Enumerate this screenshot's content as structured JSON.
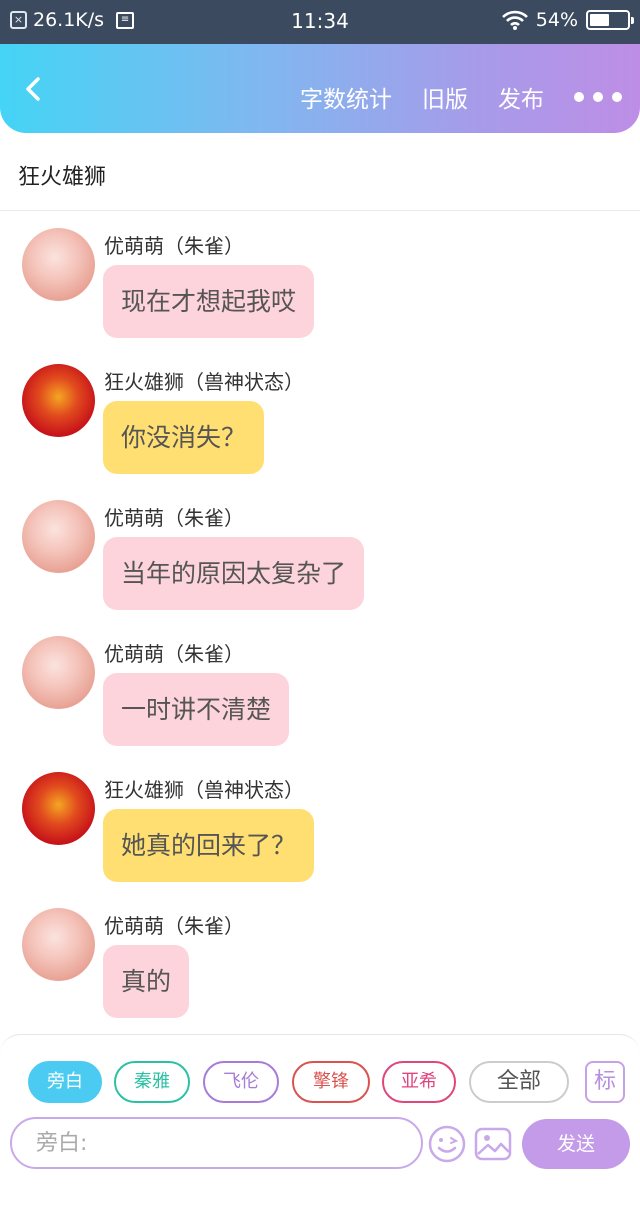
{
  "status_bar": {
    "net_speed": "26.1K/s",
    "time": "11:34",
    "battery_percent": "54%",
    "battery_level": 0.54,
    "left_icons": [
      "close-box-icon",
      "document-icon"
    ],
    "right_icons": [
      "wifi-icon",
      "battery-icon"
    ]
  },
  "nav": {
    "back_icon": "chevron-left-icon",
    "actions": [
      "字数统计",
      "旧版",
      "发布"
    ],
    "more_icon": "more-dots-icon"
  },
  "title": "狂火雄狮",
  "messages": [
    {
      "sender": "优萌萌（朱雀）",
      "text": "现在才想起我哎",
      "bubble": "pink",
      "avatar": "pink"
    },
    {
      "sender": "狂火雄狮（兽神状态）",
      "text": "你没消失？",
      "bubble": "yellow",
      "avatar": "red"
    },
    {
      "sender": "优萌萌（朱雀）",
      "text": "当年的原因太复杂了",
      "bubble": "pink",
      "avatar": "pink"
    },
    {
      "sender": "优萌萌（朱雀）",
      "text": "一时讲不清楚",
      "bubble": "pink",
      "avatar": "pink"
    },
    {
      "sender": "狂火雄狮（兽神状态）",
      "text": "她真的回来了？",
      "bubble": "yellow",
      "avatar": "red"
    },
    {
      "sender": "优萌萌（朱雀）",
      "text": "真的",
      "bubble": "pink",
      "avatar": "pink"
    }
  ],
  "characters": {
    "chips": [
      {
        "label": "旁白",
        "color": "#4ccbf2",
        "selected": true
      },
      {
        "label": "秦雅",
        "color": "#2cc0a4",
        "selected": false
      },
      {
        "label": "飞伦",
        "color": "#a77bd8",
        "selected": false
      },
      {
        "label": "擎锋",
        "color": "#d9534f",
        "selected": false
      },
      {
        "label": "亚希",
        "color": "#e0467e",
        "selected": false
      },
      {
        "label": "全部",
        "color": "#cccccc",
        "selected": false
      }
    ],
    "tag_label": "标"
  },
  "composer": {
    "placeholder": "旁白:",
    "send_label": "发送",
    "emoji_icon": "emoji-icon",
    "image_icon": "image-icon"
  },
  "colors": {
    "bubble_pink": "#fdd3dc",
    "bubble_yellow": "#ffdf72",
    "accent": "#c39be8"
  }
}
